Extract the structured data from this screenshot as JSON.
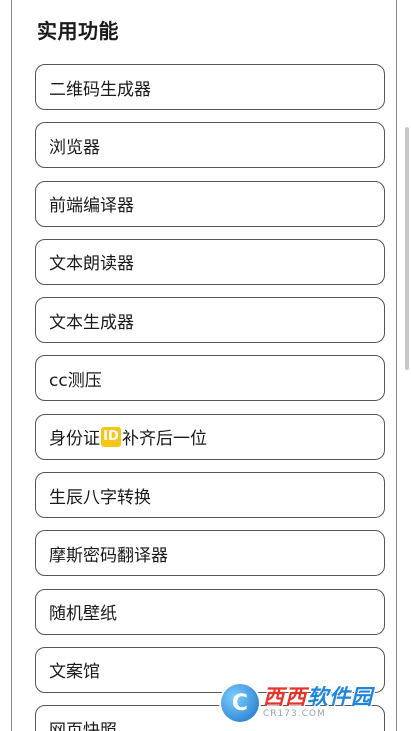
{
  "section": {
    "title": "实用功能"
  },
  "menu": {
    "items": [
      {
        "label": "二维码生成器"
      },
      {
        "label": "浏览器"
      },
      {
        "label": "前端编译器"
      },
      {
        "label": "文本朗读器"
      },
      {
        "label": "文本生成器"
      },
      {
        "label": "cc测压"
      },
      {
        "label_before": "身份证",
        "badge_icon": "id-card-icon",
        "badge_text": "ID",
        "badge_color": "#f5c518",
        "label_after": "补齐后一位"
      },
      {
        "label": "生辰八字转换"
      },
      {
        "label": "摩斯密码翻译器"
      },
      {
        "label": "随机壁纸"
      },
      {
        "label": "文案馆"
      },
      {
        "label": "网页快照"
      }
    ]
  },
  "watermark": {
    "logo_letter": "C",
    "brand_red": "西西",
    "brand_blue": "软件园",
    "domain": "CR173.COM"
  }
}
